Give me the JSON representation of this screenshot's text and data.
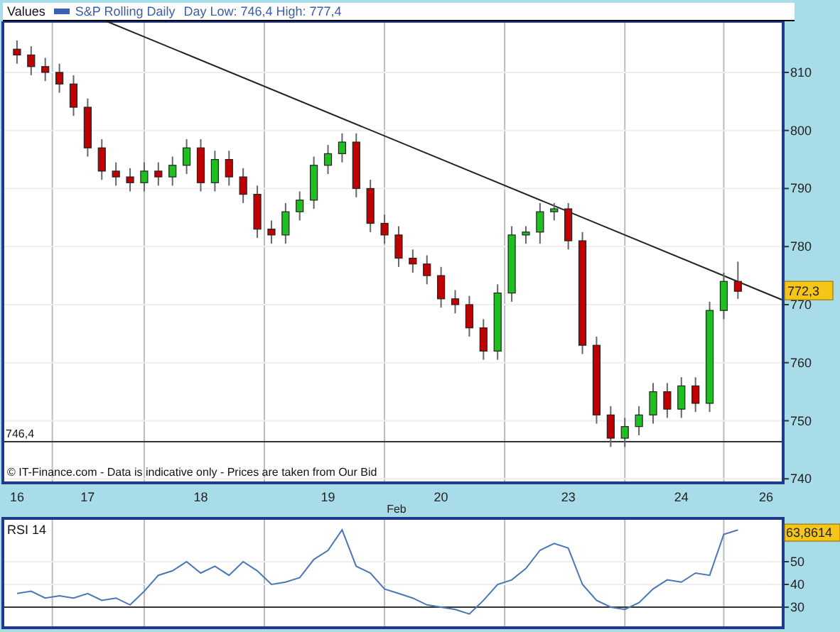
{
  "header": {
    "title": "Values",
    "legend": "S&P Rolling Daily",
    "day_range": "Day Low: 746,4 High: 777,4"
  },
  "price_chart": {
    "chart_data": {
      "type": "candlestick",
      "xlabel": "Feb",
      "grid": true,
      "ylim": [
        739.3,
        818.8
      ],
      "yticks": [
        740,
        750,
        760,
        770,
        780,
        790,
        800,
        810
      ],
      "categories": [
        "16",
        null,
        null,
        null,
        null,
        "17",
        null,
        null,
        null,
        null,
        null,
        null,
        null,
        "18",
        null,
        null,
        null,
        null,
        null,
        null,
        null,
        null,
        "19",
        null,
        null,
        null,
        null,
        null,
        null,
        null,
        "20",
        null,
        null,
        null,
        null,
        null,
        null,
        null,
        null,
        "23",
        null,
        null,
        null,
        null,
        null,
        null,
        null,
        "24",
        null,
        null,
        null,
        null,
        null,
        "26"
      ],
      "ohlc": [
        [
          814,
          815.5,
          811.5,
          813
        ],
        [
          813,
          814.5,
          809.5,
          811
        ],
        [
          811,
          812.5,
          808.5,
          810
        ],
        [
          810,
          811.5,
          806.5,
          808
        ],
        [
          808,
          809.5,
          802.5,
          804
        ],
        [
          804,
          805.5,
          795.5,
          797
        ],
        [
          797,
          798.5,
          791.5,
          793
        ],
        [
          793,
          794.5,
          790.5,
          792
        ],
        [
          792,
          793.5,
          789.5,
          791
        ],
        [
          791,
          794.5,
          789.5,
          793
        ],
        [
          793,
          794.5,
          790.5,
          792
        ],
        [
          792,
          795.5,
          790.5,
          794
        ],
        [
          794,
          798.5,
          792.5,
          797
        ],
        [
          797,
          798.5,
          789.5,
          791
        ],
        [
          791,
          796.5,
          789.5,
          795
        ],
        [
          795,
          796.5,
          790.5,
          792
        ],
        [
          792,
          793.5,
          787.5,
          789
        ],
        [
          789,
          790.5,
          781.5,
          783
        ],
        [
          783,
          784.5,
          780.5,
          782
        ],
        [
          782,
          787.5,
          780.5,
          786
        ],
        [
          786,
          789.5,
          784.5,
          788
        ],
        [
          788,
          795.5,
          786.5,
          794
        ],
        [
          794,
          797.5,
          792.5,
          796
        ],
        [
          796,
          799.5,
          794.5,
          798
        ],
        [
          798,
          799.5,
          788.5,
          790
        ],
        [
          790,
          791.5,
          782.5,
          784
        ],
        [
          784,
          785.5,
          780.5,
          782
        ],
        [
          782,
          783.5,
          776.5,
          778
        ],
        [
          778,
          779.5,
          775.5,
          777
        ],
        [
          777,
          778.5,
          773.5,
          775
        ],
        [
          775,
          776.5,
          769.5,
          771
        ],
        [
          771,
          772.5,
          768.5,
          770
        ],
        [
          770,
          771.5,
          764.5,
          766
        ],
        [
          766,
          767.5,
          760.5,
          762
        ],
        [
          762,
          773.5,
          760.5,
          772
        ],
        [
          772,
          783.5,
          770.5,
          782
        ],
        [
          782,
          783.5,
          780.5,
          782.5
        ],
        [
          782.5,
          787.5,
          780.5,
          786
        ],
        [
          786,
          787.5,
          784.5,
          786.5
        ],
        [
          786.5,
          787.5,
          779.5,
          781
        ],
        [
          781,
          782.5,
          761.5,
          763
        ],
        [
          763,
          764.5,
          749.5,
          751
        ],
        [
          751,
          752.5,
          745.5,
          747
        ],
        [
          747,
          750.5,
          745.5,
          749
        ],
        [
          749,
          752.5,
          747.5,
          751
        ],
        [
          751,
          756.5,
          749.5,
          755
        ],
        [
          755,
          756.5,
          750.5,
          752
        ],
        [
          752,
          757.5,
          750.5,
          756
        ],
        [
          756,
          757.5,
          751.5,
          753
        ],
        [
          753,
          770.5,
          751.5,
          769
        ],
        [
          769,
          775.5,
          767.5,
          774
        ],
        [
          774,
          777.4,
          771,
          772.3
        ],
        null,
        null
      ],
      "ref_lines": [
        {
          "axis": "y",
          "value": 746.4,
          "label": "746,4"
        }
      ]
    },
    "last_price": "772,3",
    "disclaimer": "© IT-Finance.com - Data is indicative only - Prices are taken from Our Bid"
  },
  "rsi_chart": {
    "chart_data": {
      "type": "line",
      "grid": true,
      "ylim": [
        21.6,
        68.4
      ],
      "yticks": [
        30,
        40,
        50
      ],
      "series": [
        {
          "name": "RSI 14",
          "color": "#4a76b8",
          "values": [
            36,
            37,
            34,
            35,
            34,
            36,
            33,
            34,
            31,
            37,
            44,
            46,
            50,
            45,
            48,
            44,
            50,
            46,
            40,
            41,
            43,
            51,
            55,
            64,
            48,
            45,
            38,
            36,
            34,
            31,
            30,
            29,
            27,
            33,
            40,
            42,
            47,
            55,
            58,
            56,
            40,
            33,
            30,
            29,
            32,
            38,
            42,
            41,
            45,
            44,
            62,
            64
          ]
        }
      ],
      "ref_lines": [
        {
          "axis": "y",
          "value": 30
        }
      ]
    },
    "last_value": "63,8614"
  }
}
